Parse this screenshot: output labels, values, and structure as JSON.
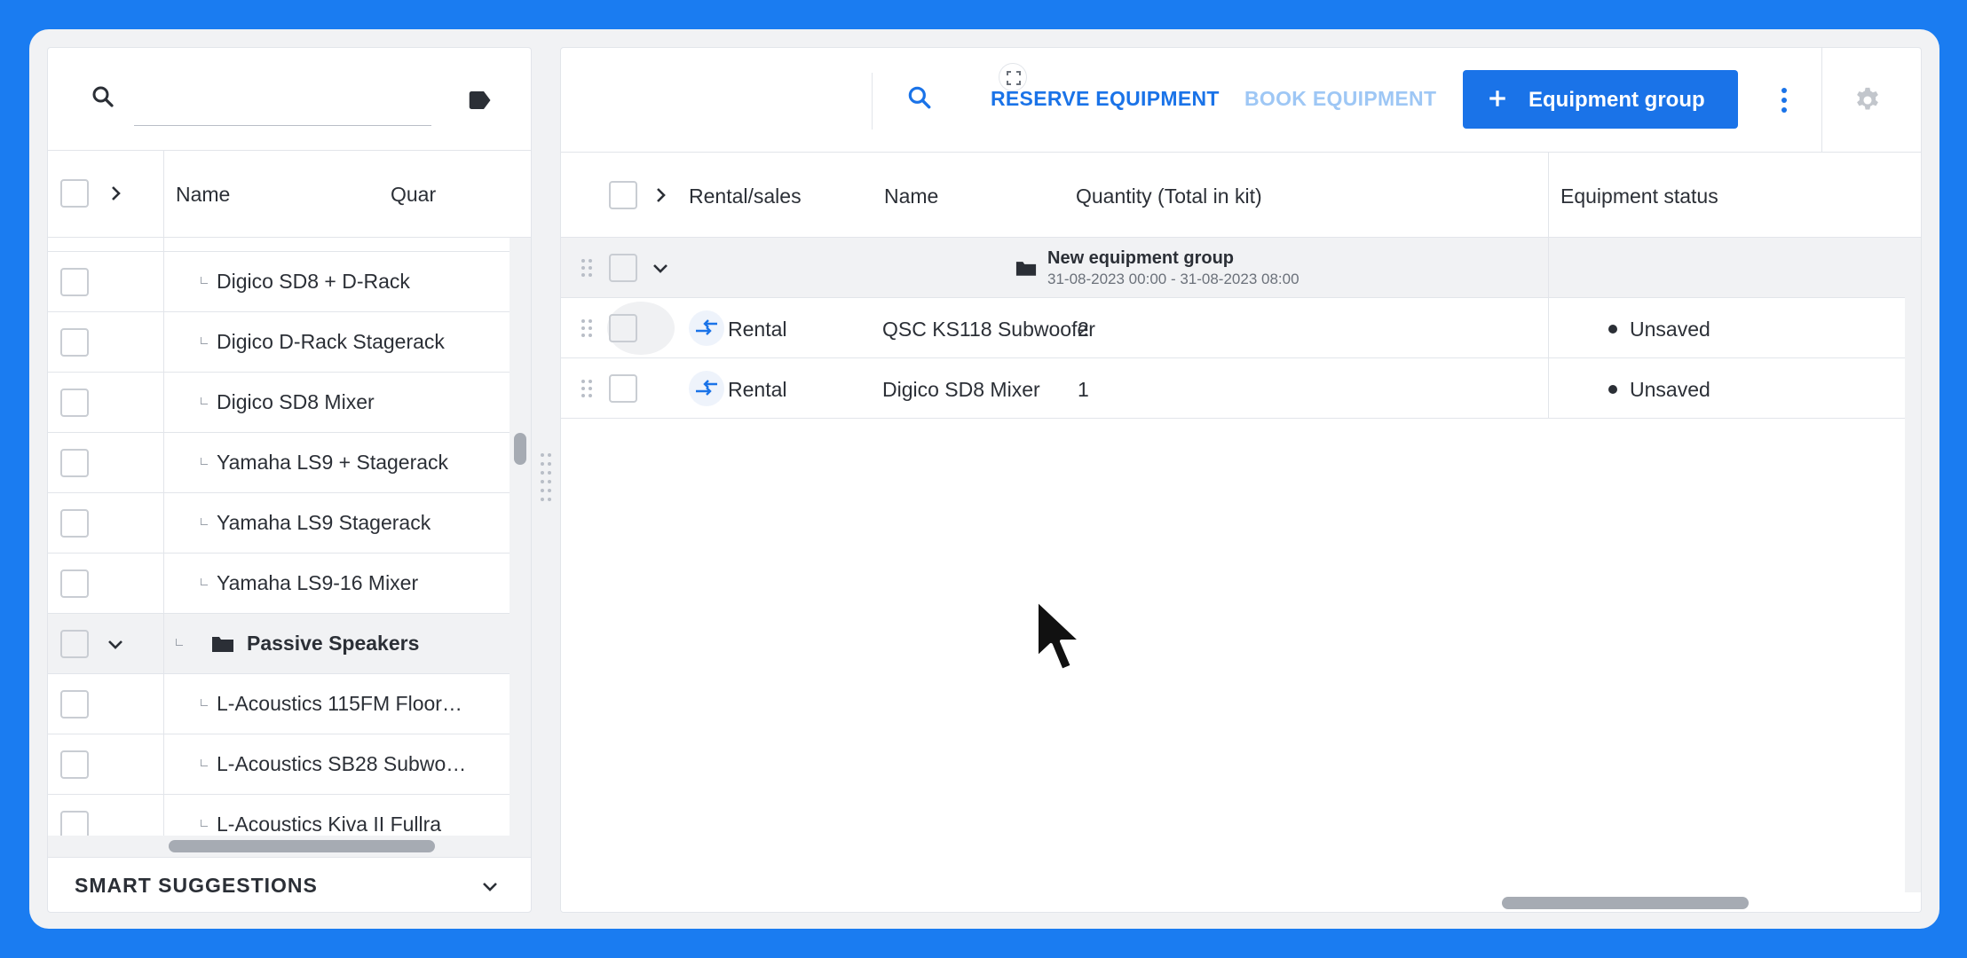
{
  "left_panel": {
    "search": {
      "value": "",
      "placeholder": ""
    },
    "columns": {
      "name": "Name",
      "quantity": "Quar"
    },
    "rows": [
      {
        "label": "Digico SD8 + D-Rack",
        "type": "item"
      },
      {
        "label": "Digico D-Rack Stagerack",
        "type": "item"
      },
      {
        "label": "Digico SD8 Mixer",
        "type": "item"
      },
      {
        "label": "Yamaha LS9 + Stagerack",
        "type": "item"
      },
      {
        "label": "Yamaha LS9 Stagerack",
        "type": "item"
      },
      {
        "label": "Yamaha LS9-16 Mixer",
        "type": "item"
      },
      {
        "label": "Passive Speakers",
        "type": "group"
      },
      {
        "label": "L-Acoustics 115FM Floor…",
        "type": "item"
      },
      {
        "label": "L-Acoustics SB28 Subwo…",
        "type": "item"
      },
      {
        "label": "L-Acoustics Kiva II Fullra",
        "type": "item"
      }
    ],
    "smart_suggestions": "SMART SUGGESTIONS"
  },
  "toolbar": {
    "reserve_label": "RESERVE EQUIPMENT",
    "book_label": "BOOK EQUIPMENT",
    "group_button_label": "Equipment group"
  },
  "table": {
    "columns": {
      "rental_sales": "Rental/sales",
      "name": "Name",
      "quantity": "Quantity (Total in kit)",
      "status": "Equipment status"
    },
    "group": {
      "name": "New equipment group",
      "dates": "31-08-2023 00:00 - 31-08-2023 08:00"
    },
    "rows": [
      {
        "type": "Rental",
        "name": "QSC KS118 Subwoofer",
        "quantity": "2",
        "status": "Unsaved"
      },
      {
        "type": "Rental",
        "name": "Digico SD8 Mixer",
        "quantity": "1",
        "status": "Unsaved"
      }
    ]
  },
  "colors": {
    "background": "#1a7cf1",
    "accent": "#1a73e8",
    "accent_disabled": "#9ec7f5",
    "text": "#2b2f36"
  },
  "icons": [
    "search-icon",
    "tag-icon",
    "chevron-right-icon",
    "chevron-down-icon",
    "folder-icon",
    "rental-arrows-icon",
    "plus-icon",
    "kebab-icon",
    "gear-icon",
    "drag-grip-icon",
    "fullscreen-icon",
    "mouse-cursor-icon"
  ]
}
